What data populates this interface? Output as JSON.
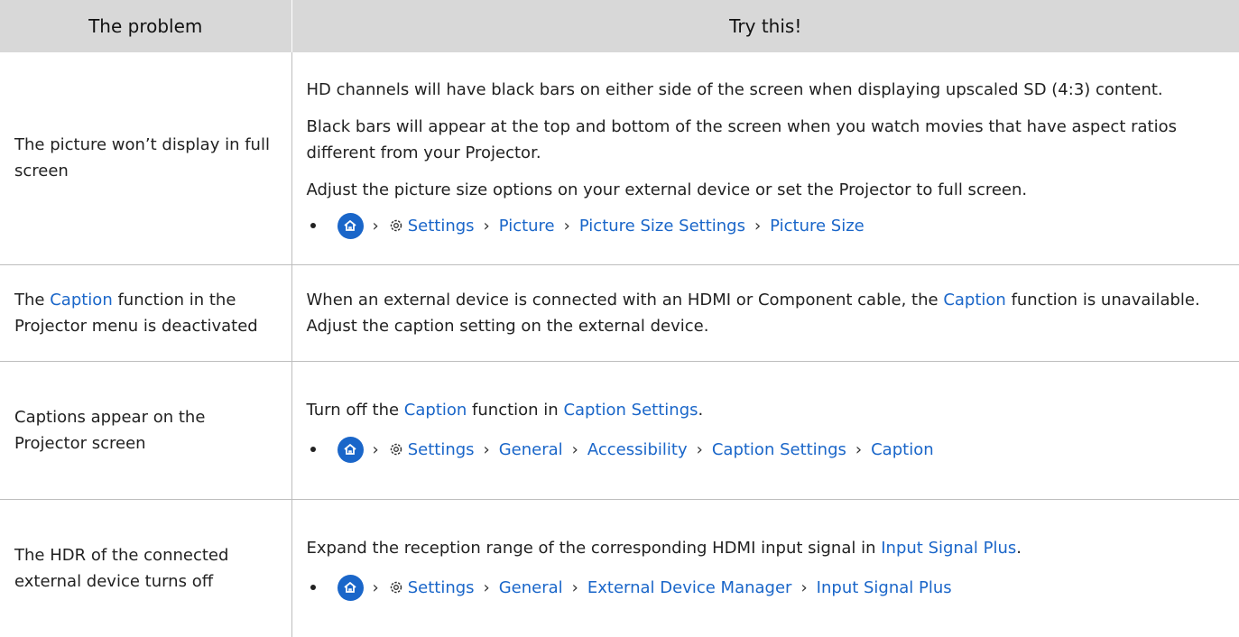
{
  "header": {
    "problem": "The problem",
    "solution": "Try this!"
  },
  "rows": [
    {
      "problem": "The picture won’t display in full screen",
      "paragraphs": [
        "HD channels will have black bars on either side of the screen when displaying upscaled SD (4:3) content.",
        "Black bars will appear at the top and bottom of the screen when you watch movies that have aspect ratios different from your Projector.",
        "Adjust the picture size options on your external device or set the Projector to full screen."
      ],
      "path": [
        "Settings",
        "Picture",
        "Picture Size Settings",
        "Picture Size"
      ]
    },
    {
      "problem_pre": "The",
      "problem_link": "Caption",
      "problem_post": "function in the Projector menu is deactivated",
      "sol_pre": "When an external device is connected with an HDMI or Component cable, the",
      "sol_link": "Caption",
      "sol_post": "function is unavailable. Adjust the caption setting on the external device."
    },
    {
      "problem": "Captions appear on the Projector screen",
      "sol_pre": "Turn off the",
      "sol_link1": "Caption",
      "sol_mid": "function in",
      "sol_link2": "Caption Settings",
      "sol_end": ".",
      "path": [
        "Settings",
        "General",
        "Accessibility",
        "Caption Settings",
        "Caption"
      ]
    },
    {
      "problem": "The HDR of the connected external device turns off",
      "sol_pre": "Expand the reception range of the corresponding HDMI input signal in",
      "sol_link": "Input Signal Plus",
      "sol_end": ".",
      "path": [
        "Settings",
        "General",
        "External Device Manager",
        "Input Signal Plus"
      ]
    }
  ],
  "colors": {
    "link": "#1a66c9",
    "header_bg": "#d8d8d8",
    "border": "#bdbdbd"
  },
  "icons": {
    "home": "home-icon",
    "settings": "gear-icon",
    "separator": "chevron-right-icon"
  }
}
